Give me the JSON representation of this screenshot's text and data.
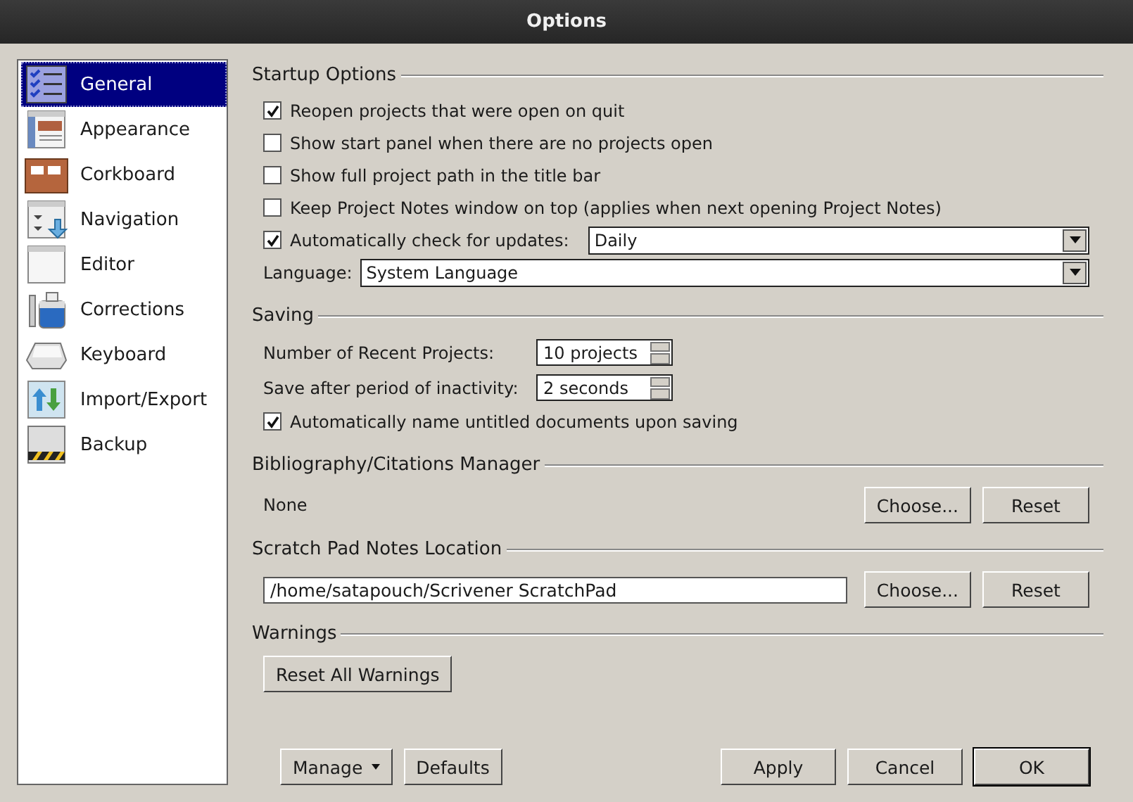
{
  "window": {
    "title": "Options"
  },
  "sidebar": {
    "items": [
      {
        "label": "General",
        "selected": true
      },
      {
        "label": "Appearance",
        "selected": false
      },
      {
        "label": "Corkboard",
        "selected": false
      },
      {
        "label": "Navigation",
        "selected": false
      },
      {
        "label": "Editor",
        "selected": false
      },
      {
        "label": "Corrections",
        "selected": false
      },
      {
        "label": "Keyboard",
        "selected": false
      },
      {
        "label": "Import/Export",
        "selected": false
      },
      {
        "label": "Backup",
        "selected": false
      }
    ]
  },
  "startup": {
    "heading": "Startup Options",
    "options": [
      {
        "label": "Reopen projects that were open on quit",
        "checked": true
      },
      {
        "label": "Show start panel when there are no projects open",
        "checked": false
      },
      {
        "label": "Show full project path in the title bar",
        "checked": false
      },
      {
        "label": "Keep Project Notes window on top (applies when next opening Project Notes)",
        "checked": false
      }
    ],
    "updates": {
      "label": "Automatically check for updates:",
      "checked": true,
      "value": "Daily"
    },
    "language": {
      "label": "Language:",
      "value": "System Language"
    }
  },
  "saving": {
    "heading": "Saving",
    "spinners": [
      {
        "label": "Number of Recent Projects:",
        "value": "10 projects"
      },
      {
        "label": "Save after period of inactivity:",
        "value": "2 seconds"
      }
    ],
    "auto_name": {
      "label": "Automatically name untitled documents upon saving",
      "checked": true
    }
  },
  "bibliography": {
    "heading": "Bibliography/Citations Manager",
    "value": "None",
    "buttons": [
      "Choose...",
      "Reset"
    ]
  },
  "scratch_pad": {
    "heading": "Scratch Pad Notes Location",
    "path": "/home/satapouch/Scrivener ScratchPad",
    "buttons": [
      "Choose...",
      "Reset"
    ]
  },
  "warnings": {
    "heading": "Warnings",
    "button": "Reset All Warnings"
  },
  "footer": {
    "left": [
      {
        "label": "Manage",
        "kind": "menu"
      },
      {
        "label": "Defaults",
        "kind": "plain"
      }
    ],
    "right": [
      {
        "label": "Apply",
        "default": false
      },
      {
        "label": "Cancel",
        "default": false
      },
      {
        "label": "OK",
        "default": true
      }
    ]
  }
}
